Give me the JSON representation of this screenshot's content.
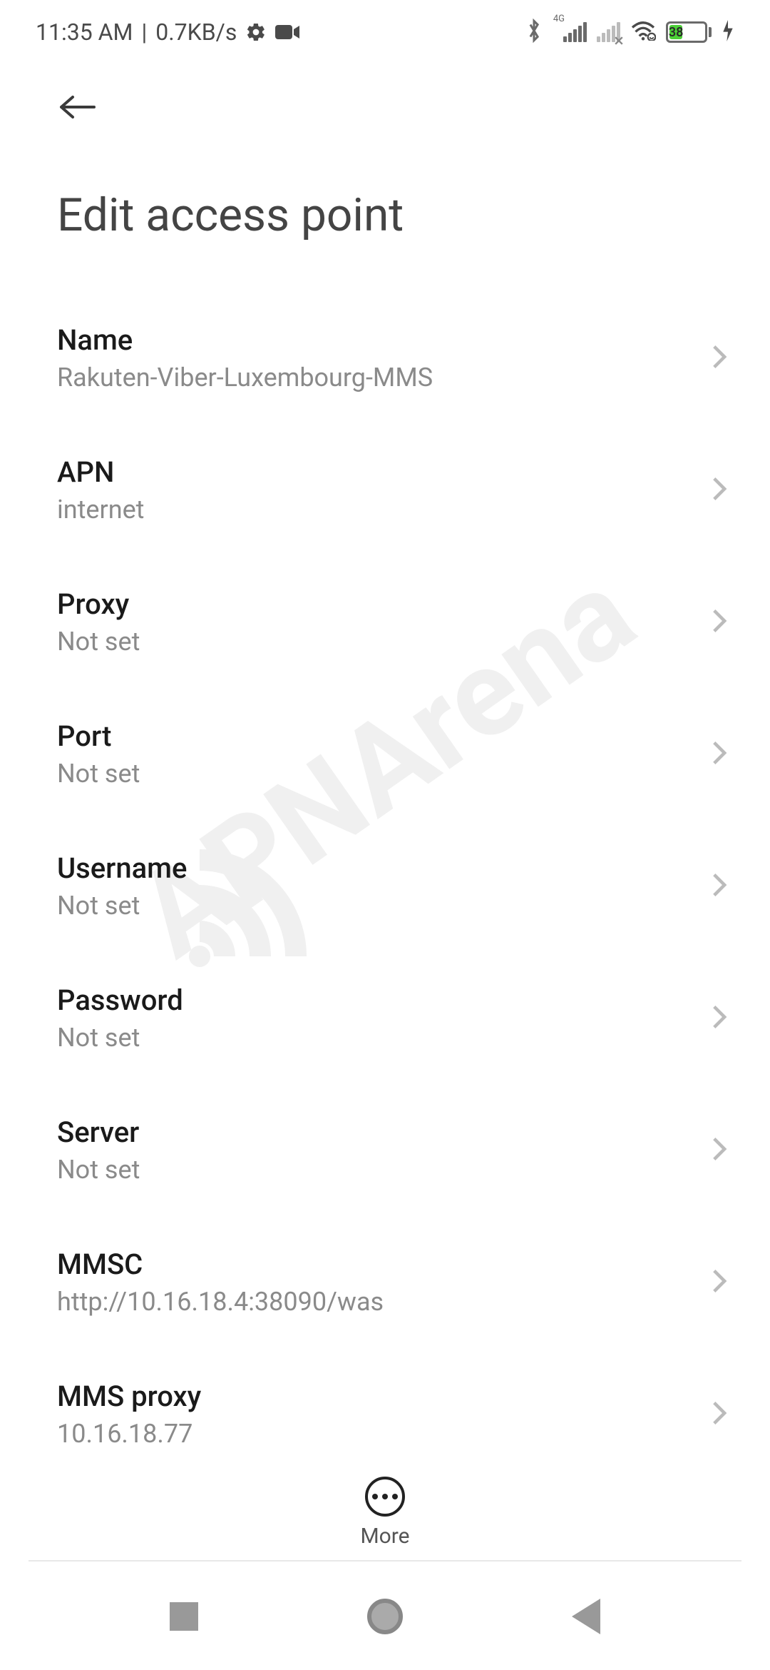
{
  "status_bar": {
    "time": "11:35 AM",
    "speed": "0.7KB/s",
    "network_label": "4G",
    "battery_percent": "38"
  },
  "header": {
    "title": "Edit access point"
  },
  "settings": [
    {
      "label": "Name",
      "value": "Rakuten-Viber-Luxembourg-MMS"
    },
    {
      "label": "APN",
      "value": "internet"
    },
    {
      "label": "Proxy",
      "value": "Not set"
    },
    {
      "label": "Port",
      "value": "Not set"
    },
    {
      "label": "Username",
      "value": "Not set"
    },
    {
      "label": "Password",
      "value": "Not set"
    },
    {
      "label": "Server",
      "value": "Not set"
    },
    {
      "label": "MMSC",
      "value": "http://10.16.18.4:38090/was"
    },
    {
      "label": "MMS proxy",
      "value": "10.16.18.77"
    }
  ],
  "bottom": {
    "more_label": "More"
  },
  "watermark": "APNArena"
}
